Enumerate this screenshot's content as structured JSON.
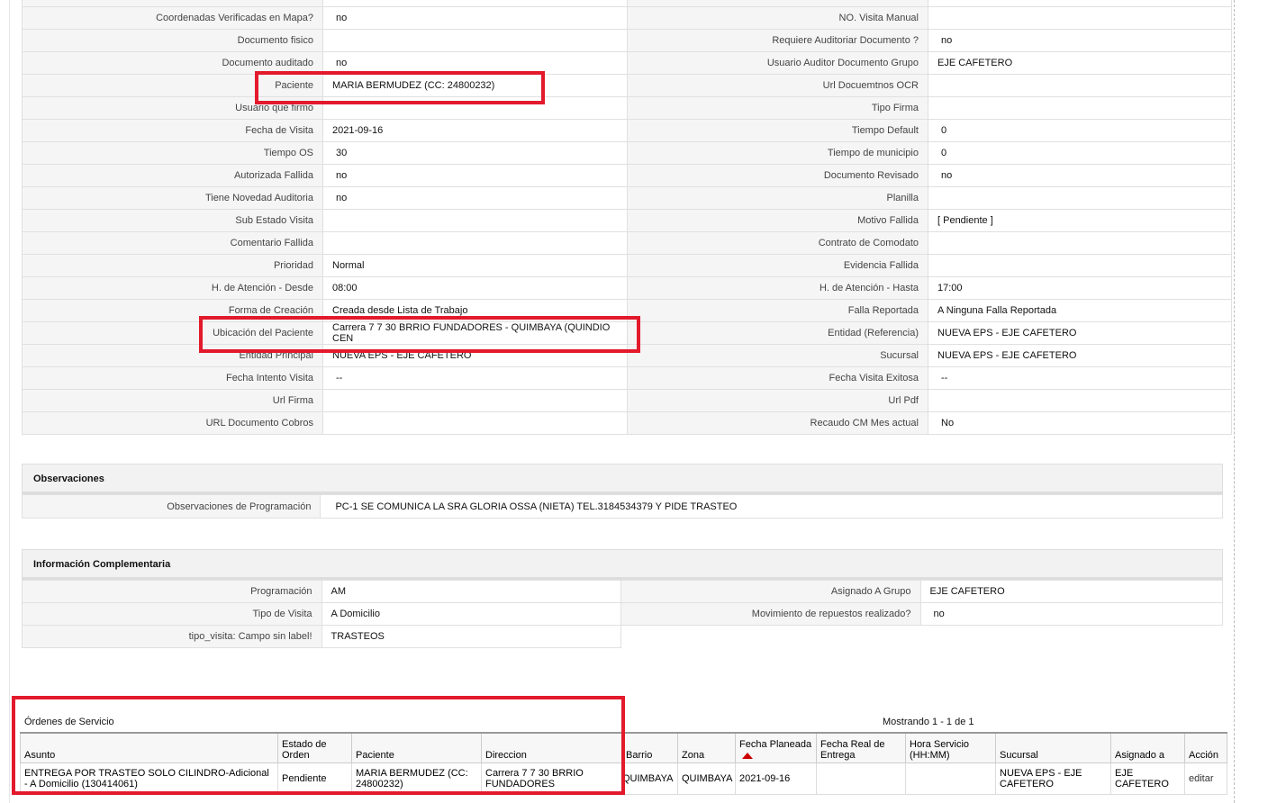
{
  "detail_rows": [
    {
      "l1": "Coordenadas Verificadas en Mapa?",
      "v1": "no",
      "l2": "NO. Visita Manual",
      "v2": ""
    },
    {
      "l1": "Documento fisico",
      "v1": "",
      "l2": "Requiere Auditoriar Documento ?",
      "v2": "no"
    },
    {
      "l1": "Documento auditado",
      "v1": "no",
      "l2": "Usuario Auditor Documento Grupo",
      "v2": "EJE CAFETERO"
    },
    {
      "l1": "Paciente",
      "v1": "MARIA BERMUDEZ (CC: 24800232)",
      "l2": "Url Docuemtnos OCR",
      "v2": ""
    },
    {
      "l1": "Usuario que firmo",
      "v1": "",
      "l2": "Tipo Firma",
      "v2": ""
    },
    {
      "l1": "Fecha de Visita",
      "v1": "2021-09-16",
      "l2": "Tiempo Default",
      "v2": "0"
    },
    {
      "l1": "Tiempo OS",
      "v1": "30",
      "l2": "Tiempo de municipio",
      "v2": "0"
    },
    {
      "l1": "Autorizada Fallida",
      "v1": "no",
      "l2": "Documento Revisado",
      "v2": "no"
    },
    {
      "l1": "Tiene Novedad Auditoria",
      "v1": "no",
      "l2": "Planilla",
      "v2": ""
    },
    {
      "l1": "Sub Estado Visita",
      "v1": "",
      "l2": "Motivo Fallida",
      "v2": "[ Pendiente ]"
    },
    {
      "l1": "Comentario Fallida",
      "v1": "",
      "l2": "Contrato de Comodato",
      "v2": ""
    },
    {
      "l1": "Prioridad",
      "v1": "Normal",
      "l2": "Evidencia Fallida",
      "v2": ""
    },
    {
      "l1": "H. de Atención - Desde",
      "v1": "08:00",
      "l2": "H. de Atención - Hasta",
      "v2": "17:00"
    },
    {
      "l1": "Forma de Creación",
      "v1": "Creada desde Lista de Trabajo",
      "l2": "Falla Reportada",
      "v2": "A Ninguna Falla Reportada"
    },
    {
      "l1": "Ubicación del Paciente",
      "v1": "Carrera 7 7 30 BRRIO FUNDADORES - QUIMBAYA (QUINDIO CEN",
      "l2": "Entidad (Referencia)",
      "v2": "NUEVA EPS - EJE CAFETERO"
    },
    {
      "l1": "Entidad Principal",
      "v1": "NUEVA EPS - EJE CAFETERO",
      "l2": "Sucursal",
      "v2": "NUEVA EPS - EJE CAFETERO"
    },
    {
      "l1": "Fecha Intento Visita",
      "v1": "--",
      "l2": "Fecha Visita Exitosa",
      "v2": "--"
    },
    {
      "l1": "Url Firma",
      "v1": "",
      "l2": "Url Pdf",
      "v2": ""
    },
    {
      "l1": "URL Documento Cobros",
      "v1": "",
      "l2": "Recaudo CM Mes actual",
      "v2": "No"
    }
  ],
  "observaciones": {
    "title": "Observaciones",
    "label": "Observaciones de Programación",
    "value": "PC-1 SE COMUNICA LA SRA GLORIA OSSA (NIETA) TEL.3184534379 Y PIDE TRASTEO"
  },
  "info": {
    "title": "Información Complementaria",
    "rows": [
      {
        "l1": "Programación",
        "v1": "AM",
        "l2": "Asignado A Grupo",
        "v2": "EJE CAFETERO"
      },
      {
        "l1": "Tipo de Visita",
        "v1": "A Domicilio",
        "l2": "Movimiento de repuestos realizado?",
        "v2": "no"
      },
      {
        "l1": "tipo_visita: Campo sin label!",
        "v1": "TRASTEOS"
      }
    ]
  },
  "orders": {
    "title": "Órdenes de Servicio",
    "showing": "Mostrando 1 - 1 de 1",
    "columns": {
      "asunto": "Asunto",
      "estado": "Estado de Orden",
      "paciente": "Paciente",
      "direccion": "Direccion",
      "barrio": "Barrio",
      "zona": "Zona",
      "fecha_planeada": "Fecha Planeada",
      "fecha_real": "Fecha Real de Entrega",
      "hora": "Hora Servicio (HH:MM)",
      "sucursal": "Sucursal",
      "asignado": "Asignado a",
      "accion": "Acción"
    },
    "row": {
      "asunto": "ENTREGA POR TRASTEO SOLO CILINDRO-Adicional - A Domicilio (130414061)",
      "estado": "Pendiente",
      "paciente": "MARIA BERMUDEZ (CC: 24800232)",
      "direccion": "Carrera 7 7 30 BRRIO FUNDADORES",
      "barrio": "QUIMBAYA",
      "zona": "QUIMBAYA",
      "fecha_planeada": "2021-09-16",
      "fecha_real": "",
      "hora": "",
      "sucursal": "NUEVA EPS - EJE CAFETERO",
      "asignado": "EJE CAFETERO",
      "accion": "editar"
    }
  },
  "colors": {
    "highlight": "#e3192c",
    "sort_arrow": "#cc0000"
  }
}
